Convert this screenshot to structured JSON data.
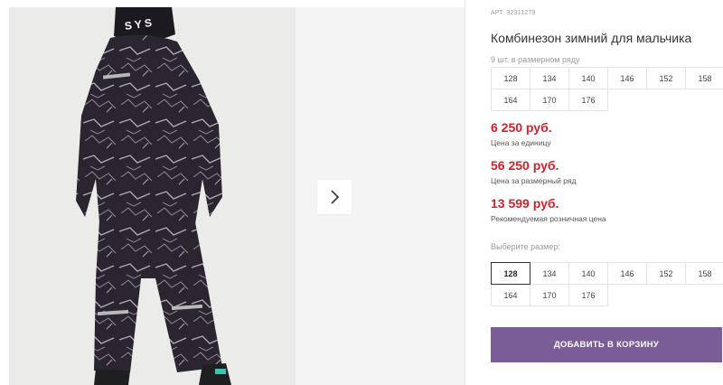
{
  "product": {
    "article": "АРТ. 32311279",
    "title": "Комбинезон зимний для мальчика"
  },
  "size_row": {
    "label": "9 шт. в размерном ряду",
    "sizes": [
      "128",
      "134",
      "140",
      "146",
      "152",
      "158",
      "164",
      "170",
      "176"
    ]
  },
  "prices": {
    "unit_price": "6 250 руб.",
    "unit_label": "Цена за единицу",
    "row_price": "56 250 руб.",
    "row_label": "Цена за размерный ряд",
    "retail_price": "13 599 руб.",
    "retail_label": "Рекомендуемая розничная цена",
    "color": "#d4202a"
  },
  "size_select": {
    "label": "Выберите размер:",
    "sizes": [
      "128",
      "134",
      "140",
      "146",
      "152",
      "158",
      "164",
      "170",
      "176"
    ],
    "selected": "128"
  },
  "cart": {
    "label": "ДОБАВИТЬ В КОРЗИНУ",
    "color": "#7a5c96"
  },
  "gallery": {
    "next_icon": "chevron-right-icon"
  }
}
